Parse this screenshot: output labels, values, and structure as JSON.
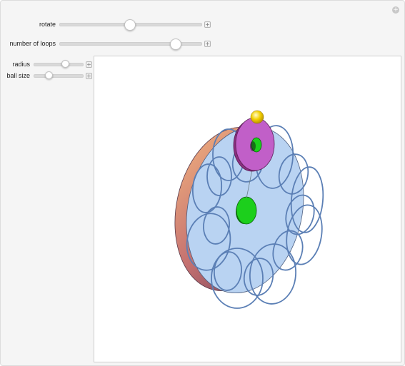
{
  "controls": {
    "rotate": {
      "label": "rotate",
      "value": 0.49
    },
    "loops": {
      "label": "number of loops",
      "value": 0.81
    },
    "radius": {
      "label": "radius",
      "value": 0.62
    },
    "ball_size": {
      "label": "ball size",
      "value": 0.28
    },
    "expand_icon": "plus-icon"
  },
  "corner_icon": "plus-circle-icon",
  "scene": {
    "disk_color": "#b9d3f2",
    "rim_color": "#e8a07a",
    "small_disk_color": "#c15fc8",
    "axle_color": "#1ccf1c",
    "ball_color": "#f3d000",
    "loop_color": "#5b7fb5"
  }
}
